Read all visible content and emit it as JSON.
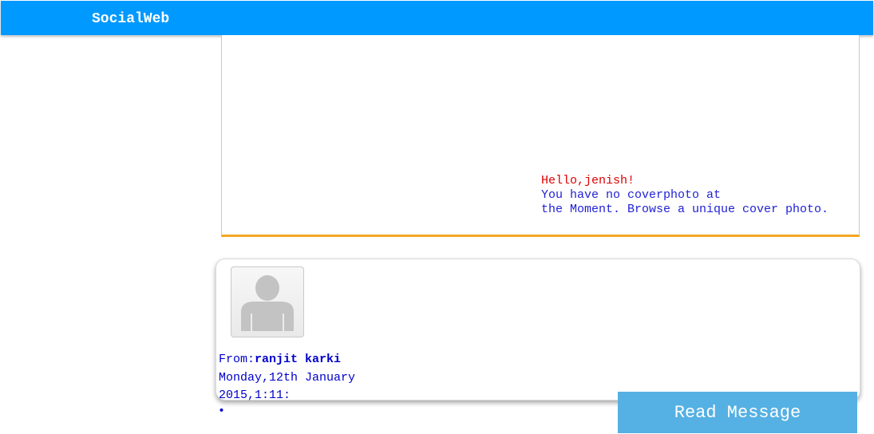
{
  "app": {
    "brand": "SocialWeb"
  },
  "cover": {
    "greeting": "Hello,jenish!",
    "line1": "You have no coverphoto at",
    "line2": "the Moment. Browse a unique cover photo."
  },
  "message": {
    "avatar_icon": "user-placeholder-icon",
    "from_label": "From:",
    "from_name": "ranjit karki",
    "date_line1": "Monday,12th January",
    "date_line2": "2015,1:11:",
    "bullet": "•",
    "read_button": "Read Message"
  },
  "colors": {
    "topbar": "#0099ff",
    "cover_border": "#f5a623",
    "greeting": "#e00000",
    "text_blue": "#0000cc",
    "button": "#55b0e3"
  }
}
